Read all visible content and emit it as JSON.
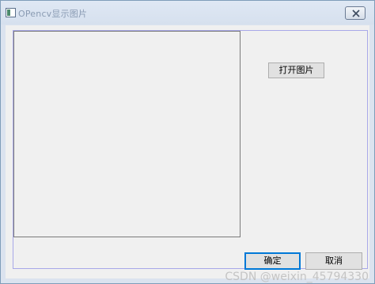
{
  "window": {
    "title": "OPencv显示图片"
  },
  "buttons": {
    "open_image": "打开图片",
    "ok": "确定",
    "cancel": "取消"
  },
  "watermark": "CSDN @weixin_45794330",
  "icons": {
    "app": "app-window-icon",
    "close": "close-icon"
  },
  "colors": {
    "focus_border": "#0078d7",
    "dialog_background": "#f0f0f0",
    "group_frame": "#a8a8e8"
  }
}
